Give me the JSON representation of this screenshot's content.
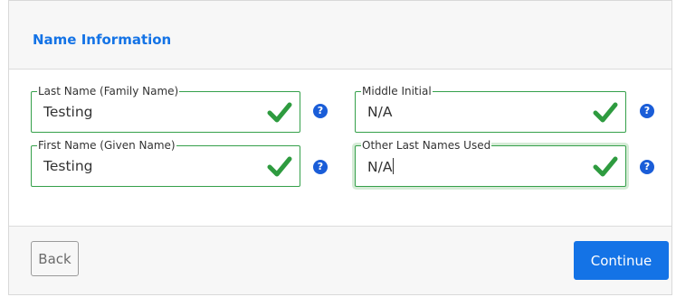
{
  "section": {
    "title": "Name Information"
  },
  "fields": {
    "last_name": {
      "label": "Last Name (Family Name)",
      "value": "Testing"
    },
    "middle_initial": {
      "label": "Middle Initial",
      "value": "N/A"
    },
    "first_name": {
      "label": "First Name (Given Name)",
      "value": "Testing"
    },
    "other_last_names": {
      "label": "Other Last Names Used",
      "value": "N/A"
    }
  },
  "help_glyph": "?",
  "icons": {
    "valid": "check-icon",
    "help": "question-circle-icon"
  },
  "footer": {
    "back_label": "Back",
    "continue_label": "Continue"
  },
  "colors": {
    "accent": "#1473e6",
    "valid": "#2e9b3f",
    "field_border": "#35a04a",
    "help": "#1a5dd8"
  }
}
